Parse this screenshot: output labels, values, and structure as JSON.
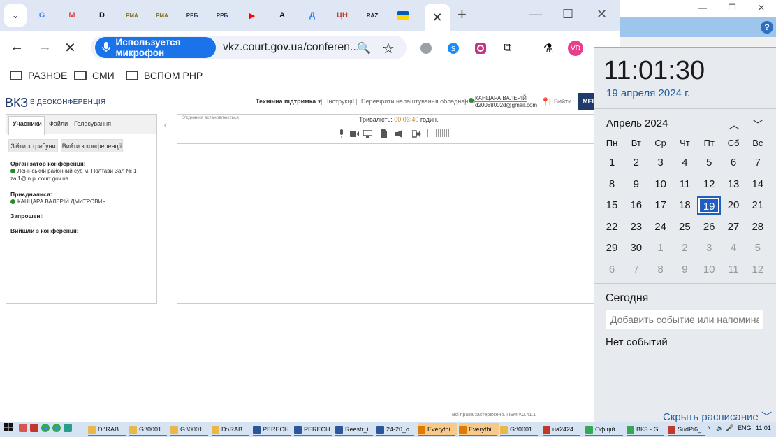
{
  "browser": {
    "tabs": [
      {
        "icon": "google-icon",
        "glyph": "G",
        "color": "#4285f4"
      },
      {
        "icon": "gmail-icon",
        "glyph": "M",
        "color": "#ea4335"
      },
      {
        "icon": "d-icon",
        "glyph": "D",
        "color": "#111111"
      },
      {
        "icon": "rma-icon",
        "glyph": "РМА",
        "color": "#8a6d1e"
      },
      {
        "icon": "rma-icon",
        "glyph": "РМА",
        "color": "#8a6d1e"
      },
      {
        "icon": "rpb-icon",
        "glyph": "РРБ",
        "color": "#1f3a6b"
      },
      {
        "icon": "rpb-icon",
        "glyph": "РРБ",
        "color": "#1f3a6b"
      },
      {
        "icon": "youtube-icon",
        "glyph": "▶",
        "color": "#ff0000"
      },
      {
        "icon": "a-icon",
        "glyph": "A",
        "color": "#111111"
      },
      {
        "icon": "d-blue-icon",
        "glyph": "Д",
        "color": "#1a73e8"
      },
      {
        "icon": "cn-icon",
        "glyph": "ЦН",
        "color": "#c0392b"
      },
      {
        "icon": "raz-icon",
        "glyph": "RAZ",
        "color": "#222222"
      },
      {
        "icon": "ukraine-flag-icon",
        "glyph": "",
        "color": "#ffd700"
      }
    ],
    "mic_label": "Используется микрофон",
    "url": "vkz.court.gov.ua/conferen...",
    "profile_initials": "VD",
    "bookmarks": [
      "РАЗНОЕ",
      "СМИ",
      "ВСПОМ РНР"
    ]
  },
  "site": {
    "logo": "ВКЗ",
    "logo_sub": "ВІДЕОКОНФЕРЕНЦІЯ",
    "support": "Технічна підтримка",
    "instructions": "Інструкції",
    "check_settings": "Перевірити налаштування обладнання",
    "user_name": "КАНЦАРА ВАЛЕРІЙ",
    "user_email": "d20088002d@gmail.com",
    "logout": "Вийти",
    "menu": "МЕНЮ",
    "tabs": [
      "Учасники",
      "Файли",
      "Голосування"
    ],
    "btn_tribune": "Зійти з трибуни",
    "btn_leave": "Вийти з конференції",
    "organizer_head": "Організатор конференції:",
    "organizer_name": "Ленінський районний суд м. Полтави Зал № 1",
    "organizer_email": "zal1@ln.pl.court.gov.ua",
    "joined_head": "Приєдналися:",
    "joined_name": "КАНЦАРА ВАЛЕРІЙ ДМИТРОВИЧ",
    "invited_head": "Запрошені:",
    "left_head": "Вийшли з конференції:",
    "connecting": "З'єднання встановлюється",
    "duration_label": "Тривалість:",
    "duration_time": "00:03:40",
    "duration_unit": "годин.",
    "copyright": "Всі права застережено. ПБМ v.2.41.1"
  },
  "calendar": {
    "time": "11:01:30",
    "date": "19 апреля 2024 г.",
    "month": "Апрель 2024",
    "weekdays": [
      "Пн",
      "Вт",
      "Ср",
      "Чт",
      "Пт",
      "Сб",
      "Вс"
    ],
    "weeks": [
      [
        1,
        2,
        3,
        4,
        5,
        6,
        7
      ],
      [
        8,
        9,
        10,
        11,
        12,
        13,
        14
      ],
      [
        15,
        16,
        17,
        18,
        19,
        20,
        21
      ],
      [
        22,
        23,
        24,
        25,
        26,
        27,
        28
      ],
      [
        29,
        30,
        1,
        2,
        3,
        4,
        5
      ],
      [
        6,
        7,
        8,
        9,
        10,
        11,
        12
      ]
    ],
    "today": 19,
    "today_label": "Сегодня",
    "event_placeholder": "Добавить событие или напоминание",
    "no_events": "Нет событий",
    "hide_schedule": "Скрыть расписание"
  },
  "taskbar": {
    "items": [
      {
        "label": "D:\\RAB...",
        "icon": "folder-icon",
        "color": "#e8b84a"
      },
      {
        "label": "G:\\0001...",
        "icon": "folder-icon",
        "color": "#e8b84a"
      },
      {
        "label": "G:\\0001...",
        "icon": "folder-icon",
        "color": "#e8b84a"
      },
      {
        "label": "D:\\RAB...",
        "icon": "folder-icon",
        "color": "#e8b84a"
      },
      {
        "label": "PERECH...",
        "icon": "word-icon",
        "color": "#2b579a"
      },
      {
        "label": "PERECH...",
        "icon": "word-icon",
        "color": "#2b579a"
      },
      {
        "label": "Reestr_i...",
        "icon": "word-icon",
        "color": "#2b579a"
      },
      {
        "label": "24-20_o...",
        "icon": "word-icon",
        "color": "#2b579a"
      },
      {
        "label": "Everythi...",
        "icon": "search-icon",
        "color": "#e07b00"
      },
      {
        "label": "Everythi...",
        "icon": "search-icon",
        "color": "#e07b00"
      },
      {
        "label": "G:\\0001...",
        "icon": "folder-icon",
        "color": "#e8b84a"
      },
      {
        "label": "ua2424 ...",
        "icon": "app-icon",
        "color": "#c0392b"
      },
      {
        "label": "Офіцій...",
        "icon": "chrome-icon",
        "color": "#34a853"
      },
      {
        "label": "ВКЗ - G...",
        "icon": "chrome-icon",
        "color": "#34a853"
      },
      {
        "label": "SudPi6_...",
        "icon": "app-icon",
        "color": "#c0392b"
      }
    ],
    "lang": "ENG",
    "clock": "11:01"
  }
}
